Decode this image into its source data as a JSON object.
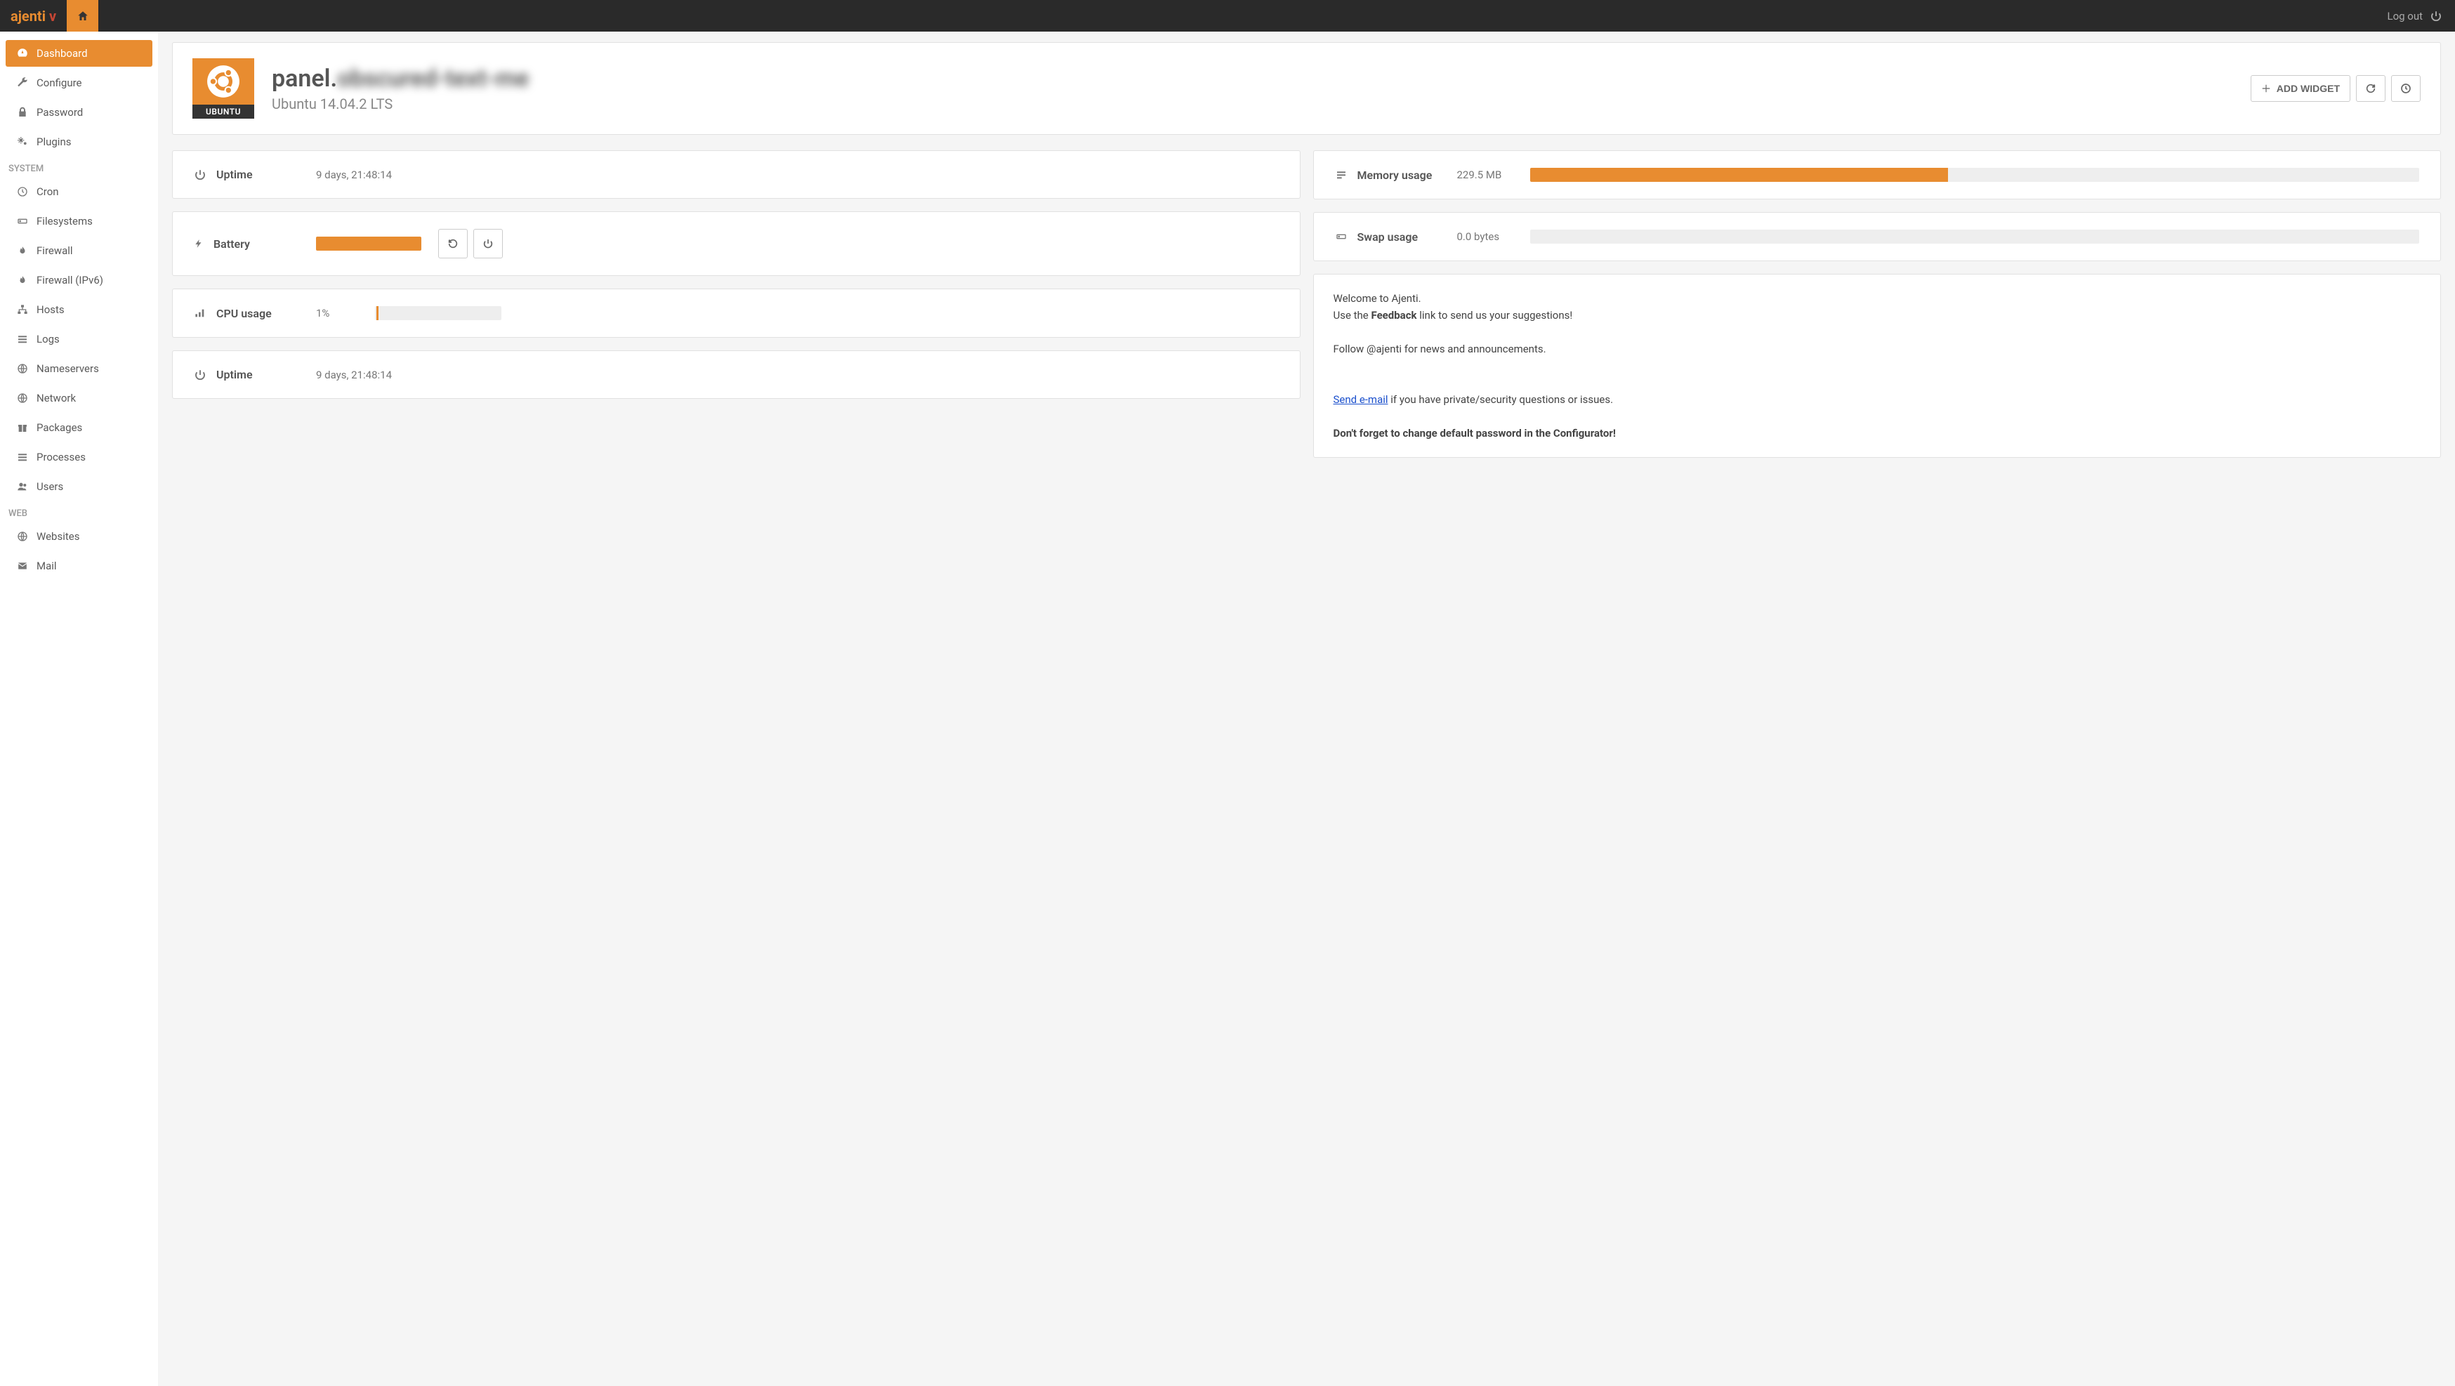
{
  "topbar": {
    "logo_a": "ajenti",
    "logo_v": " v",
    "logout_label": "Log out"
  },
  "sidebar": {
    "items_top": [
      {
        "label": "Dashboard",
        "icon": "gauge",
        "active": true
      },
      {
        "label": "Configure",
        "icon": "wrench",
        "active": false
      },
      {
        "label": "Password",
        "icon": "lock",
        "active": false
      },
      {
        "label": "Plugins",
        "icon": "cogs",
        "active": false
      }
    ],
    "section_system": "SYSTEM",
    "items_system": [
      {
        "label": "Cron",
        "icon": "clock"
      },
      {
        "label": "Filesystems",
        "icon": "hdd"
      },
      {
        "label": "Firewall",
        "icon": "fire"
      },
      {
        "label": "Firewall (IPv6)",
        "icon": "fire"
      },
      {
        "label": "Hosts",
        "icon": "sitemap"
      },
      {
        "label": "Logs",
        "icon": "list"
      },
      {
        "label": "Nameservers",
        "icon": "globe"
      },
      {
        "label": "Network",
        "icon": "globe"
      },
      {
        "label": "Packages",
        "icon": "gift"
      },
      {
        "label": "Processes",
        "icon": "list"
      },
      {
        "label": "Users",
        "icon": "users"
      }
    ],
    "section_web": "WEB",
    "items_web": [
      {
        "label": "Websites",
        "icon": "globe"
      },
      {
        "label": "Mail",
        "icon": "mail"
      }
    ]
  },
  "header": {
    "hostname_prefix": "panel.",
    "hostname_blur": "obscured-text-me",
    "os_version": "Ubuntu 14.04.2 LTS",
    "os_badge": "UBUNTU",
    "add_widget_label": "ADD WIDGET"
  },
  "widgets": {
    "left": [
      {
        "type": "uptime",
        "label": "Uptime",
        "value": "9 days, 21:48:14"
      },
      {
        "type": "battery",
        "label": "Battery",
        "fill_pct": 100
      },
      {
        "type": "cpu",
        "label": "CPU usage",
        "value": "1%",
        "fill_pct": 1
      },
      {
        "type": "uptime2",
        "label": "Uptime",
        "value": "9 days, 21:48:14"
      }
    ],
    "right": [
      {
        "type": "memory",
        "label": "Memory usage",
        "value": "229.5 MB",
        "fill_pct": 47
      },
      {
        "type": "swap",
        "label": "Swap usage",
        "value": "0.0 bytes",
        "fill_pct": 0
      }
    ]
  },
  "welcome": {
    "line1": "Welcome to Ajenti.",
    "line2a": "Use the ",
    "line2b": "Feedback",
    "line2c": " link to send us your suggestions!",
    "line3": "Follow @ajenti for news and announcements.",
    "line4_link": "Send e-mail",
    "line4_rest": " if you have private/security questions or issues.",
    "line5": "Don't forget to change default password in the Configurator!"
  }
}
